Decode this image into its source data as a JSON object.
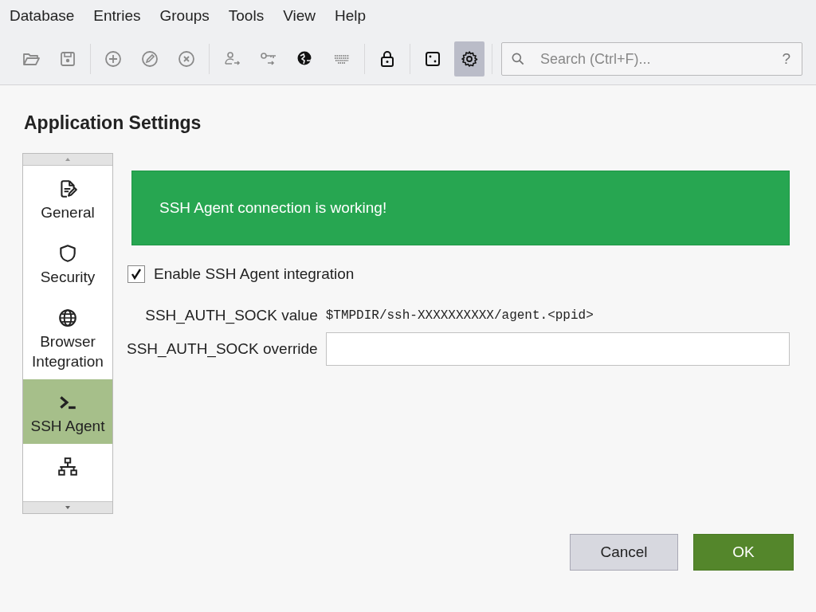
{
  "menu": [
    "Database",
    "Entries",
    "Groups",
    "Tools",
    "View",
    "Help"
  ],
  "toolbar": [
    {
      "kind": "folder",
      "disabled": true,
      "selected": false
    },
    {
      "kind": "save",
      "disabled": true,
      "selected": false
    },
    {
      "kind": "sep"
    },
    {
      "kind": "add",
      "disabled": true,
      "selected": false
    },
    {
      "kind": "edit",
      "disabled": true,
      "selected": false
    },
    {
      "kind": "delete",
      "disabled": true,
      "selected": false
    },
    {
      "kind": "sep"
    },
    {
      "kind": "user",
      "disabled": true,
      "selected": false
    },
    {
      "kind": "key",
      "disabled": true,
      "selected": false
    },
    {
      "kind": "globe",
      "disabled": false,
      "selected": false
    },
    {
      "kind": "keyboard",
      "disabled": true,
      "selected": false
    },
    {
      "kind": "sep"
    },
    {
      "kind": "lock",
      "disabled": false,
      "selected": false
    },
    {
      "kind": "sep"
    },
    {
      "kind": "dice",
      "disabled": false,
      "selected": false
    },
    {
      "kind": "gear",
      "disabled": false,
      "selected": true
    },
    {
      "kind": "sep"
    }
  ],
  "search": {
    "placeholder": "Search (Ctrl+F)...",
    "help": "?"
  },
  "title": "Application Settings",
  "sidebar": [
    {
      "kind": "document",
      "label": "General",
      "selected": false
    },
    {
      "kind": "shield",
      "label": "Security",
      "selected": false
    },
    {
      "kind": "globe",
      "label": "Browser Integration",
      "selected": false
    },
    {
      "kind": "terminal",
      "label": "SSH Agent",
      "selected": true
    },
    {
      "kind": "network",
      "selected": false
    }
  ],
  "banner": "SSH Agent connection is working!",
  "enable": {
    "label": "Enable SSH Agent integration",
    "checked": true
  },
  "sock_value": {
    "label": "SSH_AUTH_SOCK value",
    "value": "$TMPDIR/ssh-XXXXXXXXXX/agent.<ppid>"
  },
  "sock_override": {
    "label": "SSH_AUTH_SOCK override"
  },
  "buttons": [
    {
      "label": "Cancel",
      "kind": "secondary"
    },
    {
      "label": "OK",
      "kind": "primary"
    }
  ]
}
